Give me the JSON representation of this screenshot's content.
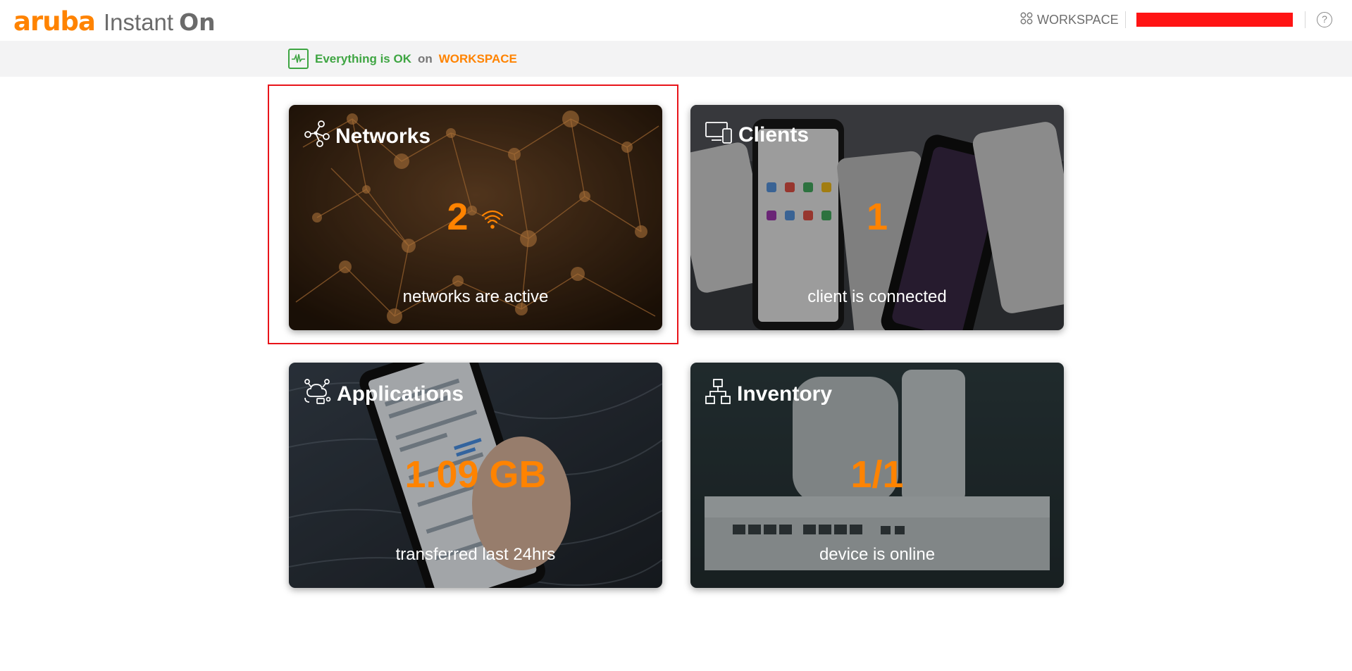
{
  "header": {
    "logo_brand": "aruba",
    "logo_product": "Instant",
    "logo_on": "On",
    "workspace_label": "WORKSPACE",
    "help_symbol": "?"
  },
  "status": {
    "message": "Everything is OK",
    "on_word": "on",
    "workspace": "WORKSPACE"
  },
  "cards": {
    "networks": {
      "title": "Networks",
      "value": "2",
      "subtitle": "networks are active"
    },
    "clients": {
      "title": "Clients",
      "value": "1",
      "subtitle": "client is connected"
    },
    "applications": {
      "title": "Applications",
      "value": "1.09 GB",
      "subtitle": "transferred last 24hrs"
    },
    "inventory": {
      "title": "Inventory",
      "value": "1/1",
      "subtitle": "device is online"
    }
  },
  "colors": {
    "accent": "#ff8300",
    "ok": "#3ea542",
    "highlight": "#e8141a"
  }
}
